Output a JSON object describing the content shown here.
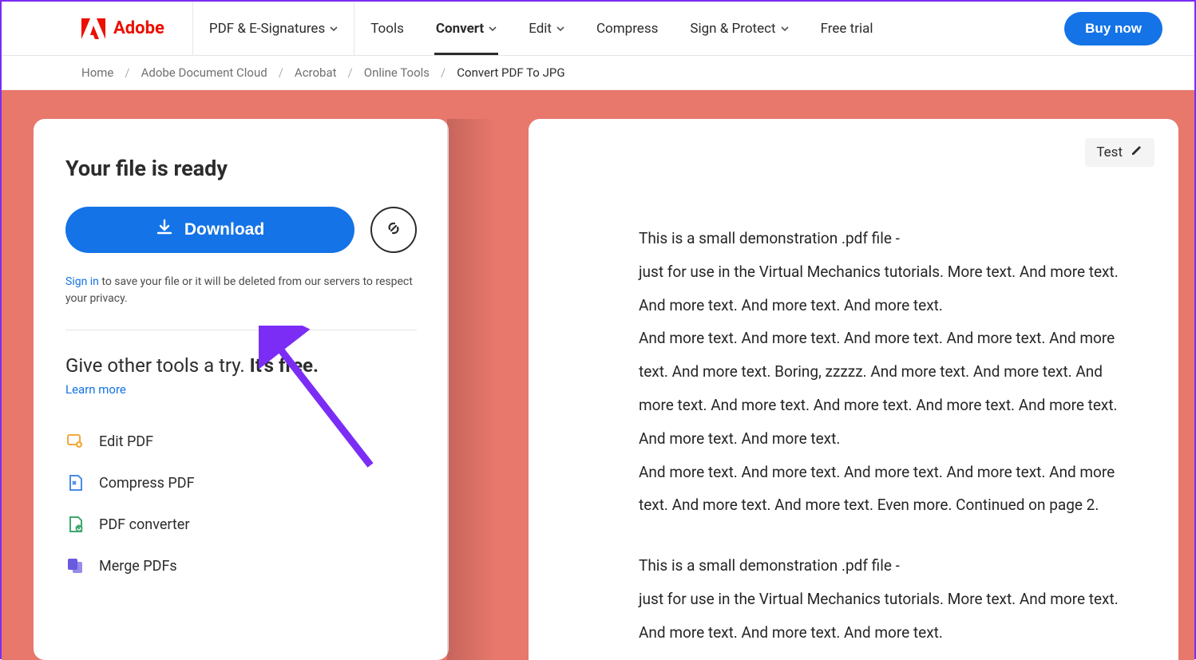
{
  "brand": {
    "name": "Adobe"
  },
  "nav": {
    "items": [
      {
        "label": "PDF & E-Signatures",
        "chevron": true,
        "active": false
      },
      {
        "label": "Tools",
        "chevron": false,
        "active": false
      },
      {
        "label": "Convert",
        "chevron": true,
        "active": true
      },
      {
        "label": "Edit",
        "chevron": true,
        "active": false
      },
      {
        "label": "Compress",
        "chevron": false,
        "active": false
      },
      {
        "label": "Sign & Protect",
        "chevron": true,
        "active": false
      },
      {
        "label": "Free trial",
        "chevron": false,
        "active": false
      }
    ],
    "buy_label": "Buy now"
  },
  "breadcrumb": {
    "items": [
      "Home",
      "Adobe Document Cloud",
      "Acrobat",
      "Online Tools",
      "Convert PDF To JPG"
    ]
  },
  "left": {
    "heading": "Your file is ready",
    "download_label": "Download",
    "signin_label": "Sign in",
    "signin_rest": " to save your file or it will be deleted from our servers to respect your privacy.",
    "tools_heading_a": "Give other tools a try. ",
    "tools_heading_b": "It's free.",
    "learn_more": "Learn more",
    "tools": [
      {
        "label": "Edit PDF"
      },
      {
        "label": "Compress PDF"
      },
      {
        "label": "PDF converter"
      },
      {
        "label": "Merge PDFs"
      }
    ]
  },
  "preview": {
    "chip_label": "Test",
    "paragraphs": [
      "This is a small demonstration .pdf file -",
      "just for use in the Virtual Mechanics tutorials. More text. And more text. And more text. And more text. And more text.",
      "And more text. And more text. And more text. And more text. And more text. And more text. Boring, zzzzz. And more text. And more text. And more text. And more text. And more text. And more text. And more text. And more text. And more text.",
      "And more text. And more text. And more text. And more text. And more text. And more text. And more text. Even more. Continued on page 2.",
      "This is a small demonstration .pdf file -",
      "just for use in the Virtual Mechanics tutorials. More text. And more text. And more text. And more text. And more text."
    ]
  }
}
